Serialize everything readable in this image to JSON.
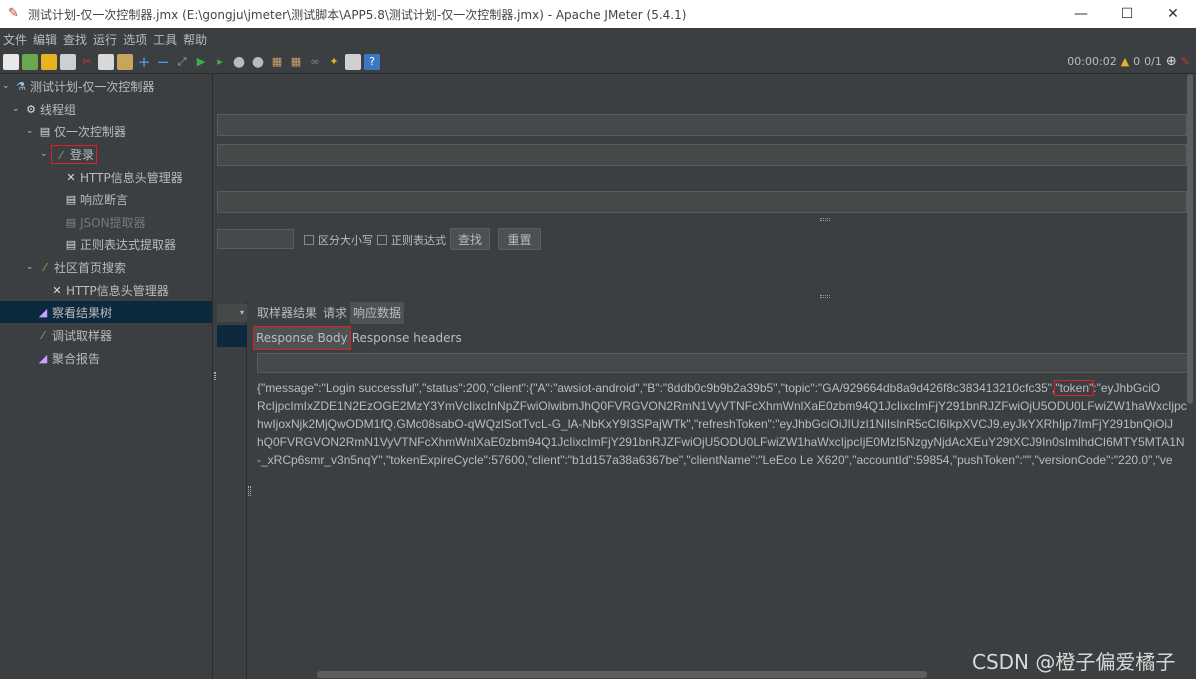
{
  "window": {
    "title": "测试计划-仅一次控制器.jmx (E:\\gongju\\jmeter\\测试脚本\\APP5.8\\测试计划-仅一次控制器.jmx) - Apache JMeter (5.4.1)",
    "minimize": "—",
    "maximize": "☐",
    "close": "✕"
  },
  "menu": [
    "文件",
    "编辑",
    "查找",
    "运行",
    "选项",
    "工具",
    "帮助"
  ],
  "toolbar": {
    "timer": "00:00:02",
    "warning_count": "0",
    "threads": "0/1"
  },
  "tree": {
    "items": [
      {
        "label": "测试计划-仅一次控制器",
        "icon": "flask-icon"
      },
      {
        "label": "线程组",
        "icon": "gear-icon"
      },
      {
        "label": "仅一次控制器",
        "icon": "controller-icon"
      },
      {
        "label": "登录",
        "icon": "pipette-icon"
      },
      {
        "label": "HTTP信息头管理器",
        "icon": "tools-icon"
      },
      {
        "label": "响应断言",
        "icon": "assertion-icon"
      },
      {
        "label": "JSON提取器",
        "icon": "extractor-icon"
      },
      {
        "label": "正则表达式提取器",
        "icon": "extractor-icon"
      },
      {
        "label": "社区首页搜索",
        "icon": "pipette-icon"
      },
      {
        "label": "HTTP信息头管理器",
        "icon": "tools-icon"
      },
      {
        "label": "察看结果树",
        "icon": "chart-icon"
      },
      {
        "label": "调试取样器",
        "icon": "pipette-icon"
      },
      {
        "label": "聚合报告",
        "icon": "chart-icon"
      }
    ]
  },
  "search": {
    "case_sensitive": "区分大小写",
    "regex": "正则表达式",
    "find_button": "查找",
    "reset_button": "重置"
  },
  "results": {
    "tabs": [
      "取样器结果",
      "请求",
      "响应数据"
    ],
    "subtabs": [
      "Response Body",
      "Response headers"
    ],
    "body_lines": [
      "{\"message\":\"Login successful\",\"status\":200,\"client\":{\"A\":\"awsiot-android\",\"B\":\"8ddb0c9b9b2a39b5\",\"topic\":\"GA/929664db8a9d426f8c383413210cfc35\",",
      "RcIjpcImIxZDE1N2EzOGE2MzY3YmVcIixcInNpZFwiOlwibmJhQ0FVRGVON2RmN1VyVTNFcXhmWnlXaE0zbm94Q1JcIixcImFjY291bnRJZFwiOjU5ODU0LFwiZW1haWxcIjpc",
      "hwIjoxNjk2MjQwODM1fQ.GMc08sabO-qWQzlSotTvcL-G_lA-NbKxY9I3SPajWTk\",\"refreshToken\":\"eyJhbGciOiJIUzI1NiIsInR5cCI6IkpXVCJ9.eyJkYXRhIjp7ImFjY291bnQiOiJ",
      "hQ0FVRGVON2RmN1VyVTNFcXhmWnlXaE0zbm94Q1JcIixcImFjY291bnRJZFwiOjU5ODU0LFwiZW1haWxcIjpcIjE0MzI5NzgyNjdAcXEuY29tXCJ9In0sImlhdCI6MTY5MTA1N",
      "-_xRCp6smr_v3n5nqY\",\"tokenExpireCycle\":57600,\"client\":\"b1d157a38a6367be\",\"clientName\":\"LeEco Le X620\",\"accountId\":59854,\"pushToken\":\"\",\"versionCode\":\"220.0\",\"ve"
    ],
    "token_highlight": "\"token\"",
    "token_rest": ":\"eyJhbGciO"
  },
  "watermark": "CSDN @橙子偏爱橘子"
}
